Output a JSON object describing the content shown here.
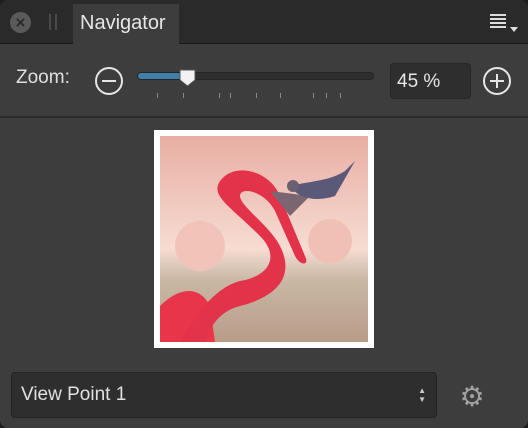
{
  "tab": {
    "title": "Navigator"
  },
  "zoom": {
    "label": "Zoom:",
    "value_text": "45 %",
    "slider_fraction": 0.18
  },
  "viewpoint": {
    "selected": "View Point 1"
  },
  "colors": {
    "accent": "#3f7fa8",
    "panel": "#3d3d3d"
  }
}
